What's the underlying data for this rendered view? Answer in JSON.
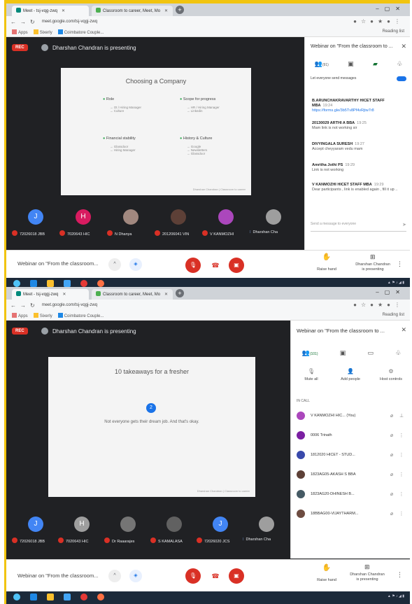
{
  "screenshots": [
    {
      "tabs": [
        "Meet - tsj-vqg-zwq",
        "Classroom to career, Meet, Mo"
      ],
      "url": "meet.google.com/tsj-vqgj-zwq",
      "bookmarks": [
        "Apps",
        "Sixerly",
        "Coimbatore Couple..."
      ],
      "reading_list": "Reading list",
      "rec_label": "REC",
      "presenting": "Dharshan Chandran is presenting",
      "slide": {
        "title": "Choosing a Company",
        "items": [
          {
            "heading": "Role",
            "bullets": [
              "Ot / Hiring Manager",
              "Culture"
            ]
          },
          {
            "heading": "Scope for progress",
            "bullets": [
              "HR / Hiring Manager",
              "Linkedin"
            ]
          },
          {
            "heading": "Financial stability",
            "bullets": [
              "Glassdoor",
              "Hiring Manager"
            ]
          },
          {
            "heading": "History & Culture",
            "bullets": [
              "Google",
              "Newsletters",
              "Glassdoor"
            ]
          }
        ],
        "footer": "Dharshan Chandran | Classroom to career"
      },
      "tiles": [
        {
          "initial": "J",
          "color": "#4285f4",
          "name": "72026018 JBB"
        },
        {
          "initial": "H",
          "color": "#d81b60",
          "name": "7020643 HIC"
        },
        {
          "initial": "",
          "color": "#a1887f",
          "name": "N Dhanya"
        },
        {
          "initial": "",
          "color": "#5d4037",
          "name": "201206041 VIN"
        },
        {
          "initial": "",
          "color": "#ab47bc",
          "name": "V KANMOZHI"
        },
        {
          "initial": "",
          "color": "#9e9e9e",
          "name": "Dharshan Cha"
        }
      ],
      "side_title": "Webinar on \"From the classroom to ...",
      "people_count": "(91)",
      "chat_toggle": "Let everyone send messages",
      "messages": [
        {
          "who": "B.ARUNCHAKRAVARTHY HICET STAFF MBA",
          "time": "19:24",
          "text": "https://forms.gle/3b5Tv8Pf4vRjtw7r8",
          "link": true
        },
        {
          "who": "20130029 ARTHI A BBA",
          "time": "19:25",
          "text": "Mam link is not working sir",
          "link": false
        },
        {
          "who": "DIVYINGALA SURESH",
          "time": "19:27",
          "text": "Accept cheyyaram vedu mam",
          "link": false
        },
        {
          "who": "Amritha Jothi PS",
          "time": "19:29",
          "text": "Link is not working",
          "link": false
        },
        {
          "who": "V KANMOZHI HICET STAFF MBA",
          "time": "19:29",
          "text": "Dear participants , link is enabled again , fill it up ..",
          "link": false
        }
      ],
      "chat_placeholder": "Send a message to everyone",
      "meeting_name": "Webinar on \"From the classroom...",
      "raise_hand": "Raise hand",
      "presenting_ctl": "Dharshan Chandran\nis presenting"
    },
    {
      "tabs": [
        "Meet - tsj-vqgj-zwq",
        "Classroom to career, Meet, Mo"
      ],
      "url": "meet.google.com/tsj-vqgj-zwq",
      "bookmarks": [
        "Apps",
        "Sixerly",
        "Coimbatore Couple..."
      ],
      "reading_list": "Reading list",
      "rec_label": "REC",
      "presenting": "Dharshan Chandran is presenting",
      "slide": {
        "title": "10 takeaways for a fresher",
        "number": "2",
        "text": "Not everyone gets their dream job. And that's okay.",
        "footer": "Dharshan Chandran | Classroom to career"
      },
      "tiles": [
        {
          "initial": "J",
          "color": "#4285f4",
          "name": "72026018 JBB"
        },
        {
          "initial": "H",
          "color": "#9e9e9e",
          "name": "7020643 HIC"
        },
        {
          "initial": "",
          "color": "#757575",
          "name": "Dr Raaarajes"
        },
        {
          "initial": "",
          "color": "#616161",
          "name": "S KAMALASA"
        },
        {
          "initial": "J",
          "color": "#4285f4",
          "name": "72026020 JCS"
        },
        {
          "initial": "",
          "color": "#9e9e9e",
          "name": "Dharshan Cha"
        }
      ],
      "side_title": "Webinar on \"From the classroom to ...",
      "people_count": "(101)",
      "actions": [
        "Mute all",
        "Add people",
        "Host controls"
      ],
      "section_label": "IN CALL",
      "participants": [
        {
          "name": "V KANMOZHI HIC... (You)",
          "color": "#ab47bc"
        },
        {
          "name": "0006 Trinath",
          "color": "#7b1fa2"
        },
        {
          "name": "1812020 HICET - STUD...",
          "color": "#3949ab"
        },
        {
          "name": "1823AG05-AKASH S BBA",
          "color": "#5d4037"
        },
        {
          "name": "1823AG20-DHINESH B...",
          "color": "#455a64"
        },
        {
          "name": "18BBAG00-VIJAYTHARM...",
          "color": "#6d4c41"
        }
      ],
      "meeting_name": "Webinar on \"From the classroom...",
      "raise_hand": "Raise hand",
      "presenting_ctl": "Dharshan Chandran\nis presenting"
    }
  ]
}
